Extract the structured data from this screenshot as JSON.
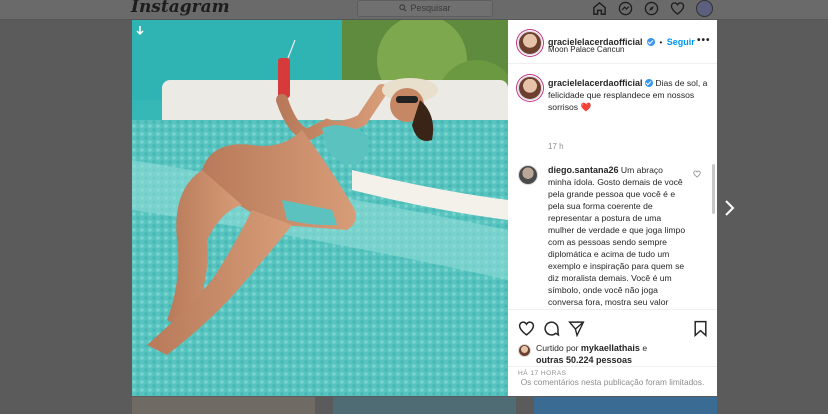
{
  "topbar": {
    "logo": "Instagram",
    "search_placeholder": "Pesquisar"
  },
  "post": {
    "username": "gracielelacerdaofficial",
    "follow_label": "Seguir",
    "separator": "•",
    "location": "Moon Palace Cancun",
    "more_label": "•••",
    "caption_text": "Dias de sol, a felicidade que resplandece em nossos sorrisos ❤️",
    "caption_time": "17 h",
    "comment": {
      "username": "diego.santana26",
      "text": "Um abraço minha ídola. Gosto demais de você pela grande pessoa que você é e pela sua forma coerente de representar a postura de uma mulher de verdade e que joga limpo com as pessoas sendo sempre diplomática e acima de tudo um exemplo e inspiração para quem se diz moralista demais. Você é um símbolo, onde você não joga conversa fora, mostra seu valor"
    },
    "likes": {
      "prefix": "Curtido por",
      "liker": "mykaellathais",
      "connector": "e",
      "others": "outras 50.224 pessoas"
    },
    "timestamp": "HÁ 17 HORAS",
    "comments_limited": "Os comentários nesta publicação foram limitados."
  },
  "colors": {
    "accent": "#0095f6",
    "verified": "#3897f0",
    "heart": "#ed4956",
    "pool": "#2ab2b3"
  }
}
